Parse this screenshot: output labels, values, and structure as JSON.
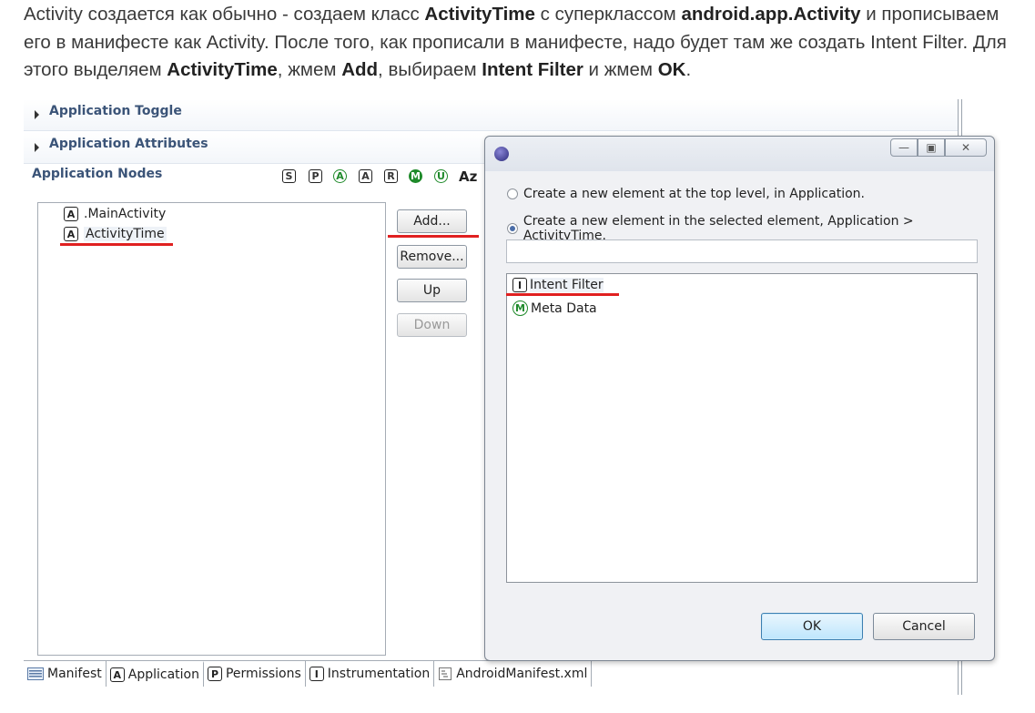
{
  "paragraph": {
    "part1": "Activity создается как обычно - создаем класс ",
    "b1": "ActivityTime",
    "part2": " с суперклассом ",
    "b2": "android.app.Activity",
    "part3": " и прописываем его в манифесте как Activity. После того, как прописали в манифесте, надо будет там же создать Intent Filter. Для этого выделяем ",
    "b3": "ActivityTime",
    "part4": ", жмем ",
    "b4": "Add",
    "part5": ", выбираем ",
    "b5": "Intent Filter",
    "part6": " и жмем ",
    "b6": "OK",
    "part7": "."
  },
  "editor": {
    "sections": [
      {
        "label": "Application Toggle"
      },
      {
        "label": "Application Attributes"
      }
    ],
    "nodes_header": "Application Nodes",
    "toolbar": [
      "S",
      "P",
      "A",
      "A",
      "R",
      "M",
      "U"
    ],
    "sort_label": "Az",
    "tree": [
      {
        "icon": "A",
        "label": ".MainActivity"
      },
      {
        "icon": "A",
        "label": "ActivityTime"
      }
    ],
    "buttons": {
      "add": "Add...",
      "remove": "Remove...",
      "up": "Up",
      "down": "Down"
    },
    "tabs": [
      {
        "icon": "manifest-icon",
        "label": "Manifest"
      },
      {
        "icon": "A",
        "label": "Application"
      },
      {
        "icon": "P",
        "label": "Permissions"
      },
      {
        "icon": "I",
        "label": "Instrumentation"
      },
      {
        "icon": "xml-icon",
        "label": "AndroidManifest.xml"
      }
    ]
  },
  "dialog": {
    "options": [
      {
        "label": "Create a new element at the top level, in Application.",
        "selected": false
      },
      {
        "label": "Create a new element in the selected element, Application > ActivityTime.",
        "selected": true
      }
    ],
    "filter_value": "",
    "list": [
      {
        "icon": "I",
        "label": "Intent Filter"
      },
      {
        "icon": "M",
        "label": "Meta Data"
      }
    ],
    "ok": "OK",
    "cancel": "Cancel"
  },
  "colors": {
    "underline": "#e02020",
    "section_text": "#3b5478",
    "green_icon": "#1f8a2a"
  }
}
